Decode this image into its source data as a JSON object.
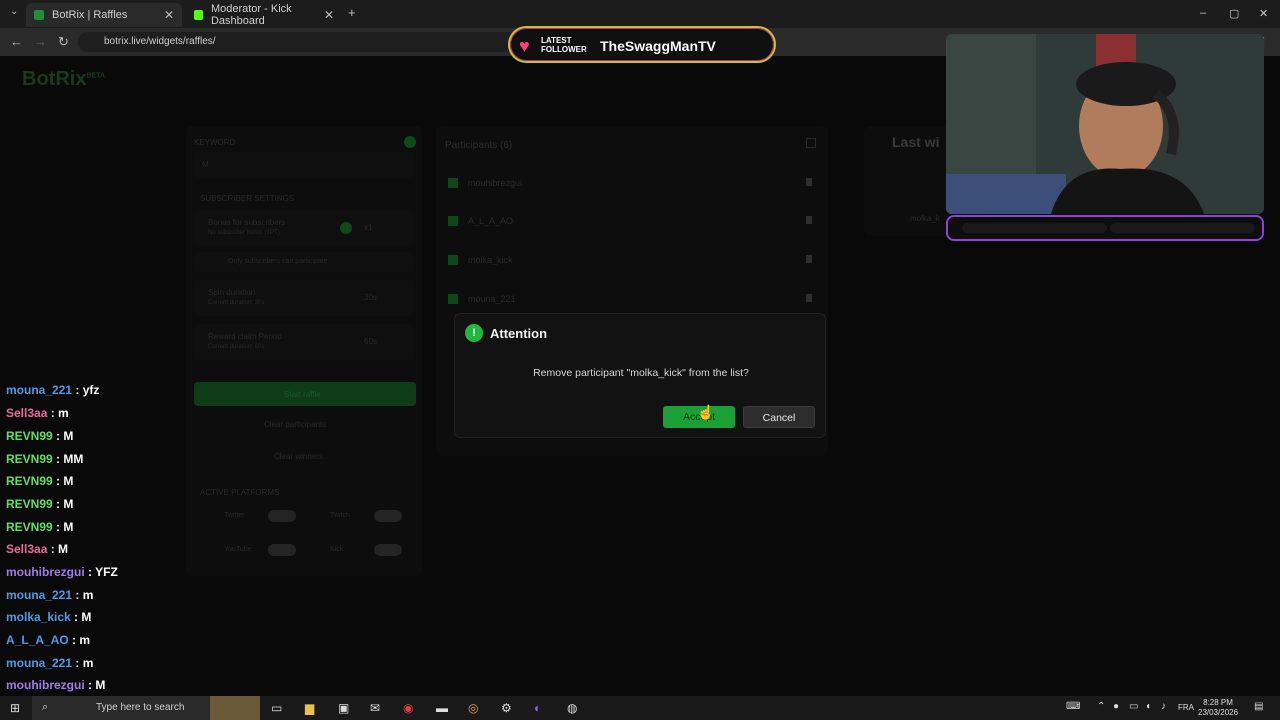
{
  "browser": {
    "tabs": [
      {
        "title": "BotRix | Raffles",
        "favicon_color": "#1f8f3a"
      },
      {
        "title": "Moderator - Kick Dashboard",
        "favicon_color": "#53fc18"
      }
    ],
    "url": "botrix.live/widgets/raffles/",
    "new_tab": "+"
  },
  "page": {
    "brand": "BotRix",
    "brand_tag": "BETA",
    "keyword_label": "KEYWORD",
    "keyword_value": "M",
    "subscriber_settings": "SUBSCRIBER SETTINGS",
    "bonus_label": "Bonus for subscribers",
    "bonus_sub": "No subscriber bonus (1PT)",
    "bonus_value": "x1",
    "only_subs": "Only subscribers can participate",
    "spin_label": "Spin duration",
    "spin_sub": "Current duration: 30s",
    "spin_value": "30s",
    "reward_label": "Reward claim Period",
    "reward_sub": "Current duration: 60s",
    "reward_value": "60s",
    "start_raffle": "Start raffle",
    "clear_participants": "Clear participants",
    "clear_winners": "Clear winners",
    "active_platforms": "ACTIVE PLATFORMS",
    "platforms": [
      "Twitter",
      "Twitch",
      "YouTube",
      "Kick"
    ],
    "participants_title": "Participants (6)",
    "participants": [
      "mouhibrezgui",
      "A_L_A_AO",
      "molka_kick",
      "mouna_221"
    ],
    "last_winners_title": "Last wi",
    "last_winner": "molka_k"
  },
  "dialog": {
    "title": "Attention",
    "icon": "exclamation-icon",
    "message": "Remove participant \"molka_kick\" from the list?",
    "accept": "Accept",
    "cancel": "Cancel"
  },
  "overlay": {
    "follower_label": "LATEST FOLLOWER",
    "follower_name": "TheSwaggManTV"
  },
  "chat": [
    {
      "user": "mouna_221",
      "color": "#4a9be8",
      "msg": "yfz"
    },
    {
      "user": "Sell3aa",
      "color": "#e86a9a",
      "msg": "m"
    },
    {
      "user": "REVN99",
      "color": "#5ee05e",
      "msg": "M"
    },
    {
      "user": "REVN99",
      "color": "#5ee05e",
      "msg": "MM"
    },
    {
      "user": "REVN99",
      "color": "#5ee05e",
      "msg": "M"
    },
    {
      "user": "REVN99",
      "color": "#5ee05e",
      "msg": "M"
    },
    {
      "user": "REVN99",
      "color": "#5ee05e",
      "msg": "M"
    },
    {
      "user": "Sell3aa",
      "color": "#e86a9a",
      "msg": "M"
    },
    {
      "user": "mouhibrezgui",
      "color": "#a07be8",
      "msg": "YFZ"
    },
    {
      "user": "mouna_221",
      "color": "#4a9be8",
      "msg": "m"
    },
    {
      "user": "molka_kick",
      "color": "#4a9be8",
      "msg": "M"
    },
    {
      "user": "A_L_A_AO",
      "color": "#4a9be8",
      "msg": "m"
    },
    {
      "user": "mouna_221",
      "color": "#4a9be8",
      "msg": "m"
    },
    {
      "user": "mouhibrezgui",
      "color": "#a07be8",
      "msg": "M"
    }
  ],
  "taskbar": {
    "search_placeholder": "Type here to search",
    "lang": "FRA",
    "time": "8:28 PM",
    "date": "23/03/2026"
  }
}
